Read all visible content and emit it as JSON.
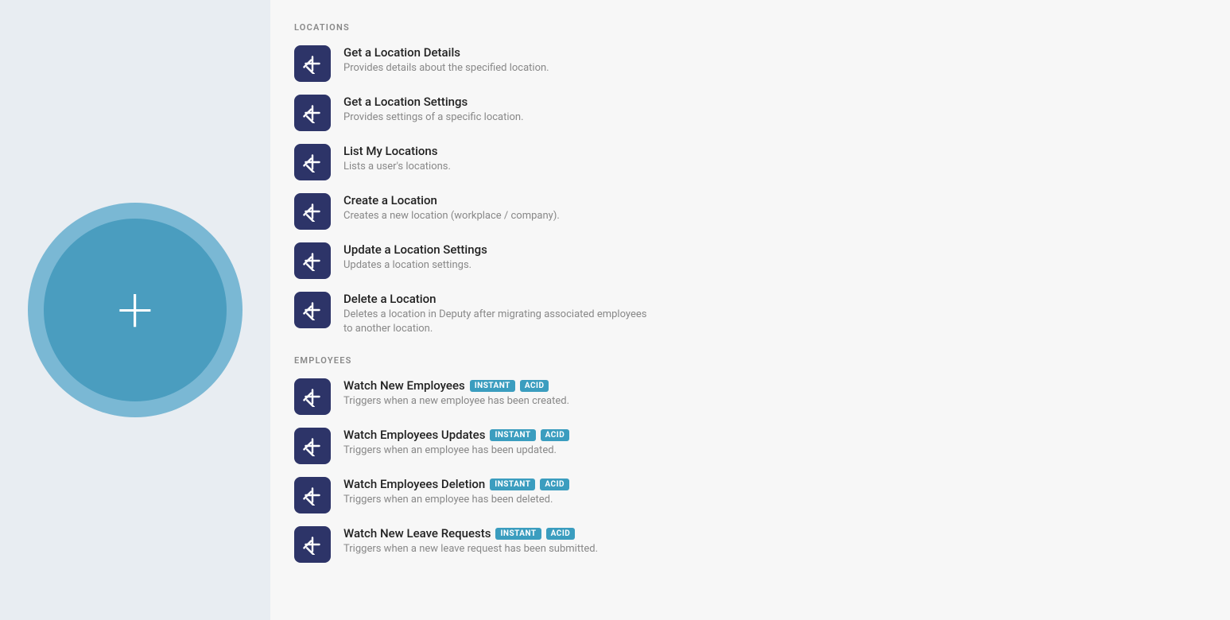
{
  "left": {
    "plus_symbol": "+"
  },
  "sections": [
    {
      "id": "locations",
      "label": "LOCATIONS",
      "items": [
        {
          "id": "get-location-details",
          "title": "Get a Location Details",
          "description": "Provides details about the specified location.",
          "badges": []
        },
        {
          "id": "get-location-settings",
          "title": "Get a Location Settings",
          "description": "Provides settings of a specific location.",
          "badges": []
        },
        {
          "id": "list-my-locations",
          "title": "List My Locations",
          "description": "Lists a user's locations.",
          "badges": []
        },
        {
          "id": "create-a-location",
          "title": "Create a Location",
          "description": "Creates a new location (workplace / company).",
          "badges": []
        },
        {
          "id": "update-a-location-settings",
          "title": "Update a Location Settings",
          "description": "Updates a location settings.",
          "badges": []
        },
        {
          "id": "delete-a-location",
          "title": "Delete a Location",
          "description": "Deletes a location in Deputy after migrating associated employees to another location.",
          "badges": []
        }
      ]
    },
    {
      "id": "employees",
      "label": "EMPLOYEES",
      "items": [
        {
          "id": "watch-new-employees",
          "title": "Watch New Employees",
          "description": "Triggers when a new employee has been created.",
          "badges": [
            "INSTANT",
            "ACID"
          ]
        },
        {
          "id": "watch-employees-updates",
          "title": "Watch Employees Updates",
          "description": "Triggers when an employee has been updated.",
          "badges": [
            "INSTANT",
            "ACID"
          ]
        },
        {
          "id": "watch-employees-deletion",
          "title": "Watch Employees Deletion",
          "description": "Triggers when an employee has been deleted.",
          "badges": [
            "INSTANT",
            "ACID"
          ]
        },
        {
          "id": "watch-new-leave-requests",
          "title": "Watch New Leave Requests",
          "description": "Triggers when a new leave request has been submitted.",
          "badges": [
            "INSTANT",
            "ACID"
          ]
        }
      ]
    }
  ]
}
